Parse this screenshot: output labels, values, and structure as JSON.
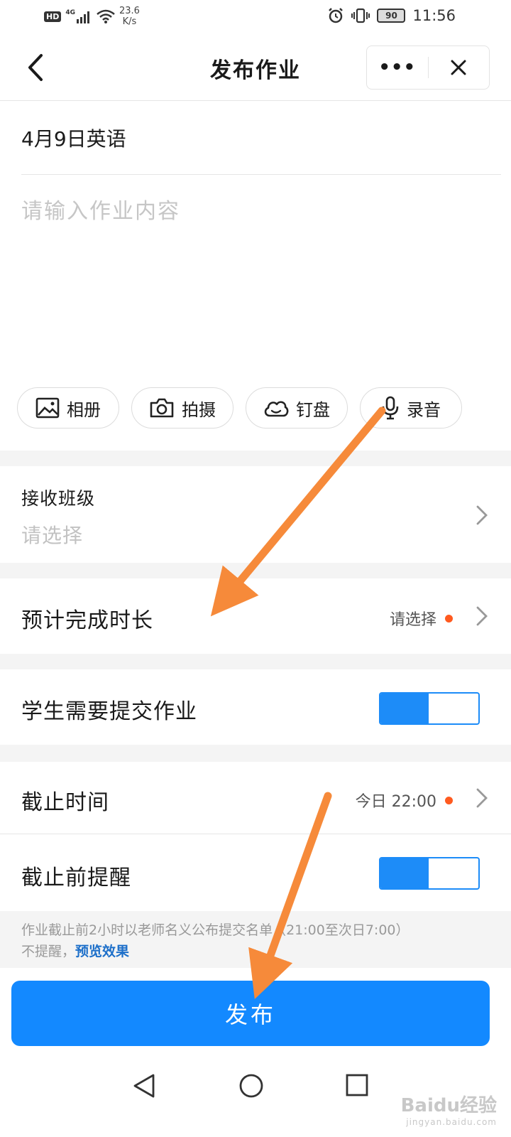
{
  "status_bar": {
    "hd": "HD",
    "network": "4G",
    "speed_value": "23.6",
    "speed_unit": "K/s",
    "battery": "90",
    "time": "11:56"
  },
  "nav": {
    "title": "发布作业",
    "more_label": "•••"
  },
  "form": {
    "title_value": "4月9日英语",
    "content_placeholder": "请输入作业内容"
  },
  "attachments": [
    {
      "label": "相册",
      "icon": "image-icon"
    },
    {
      "label": "拍摄",
      "icon": "camera-icon"
    },
    {
      "label": "钉盘",
      "icon": "cloud-icon"
    },
    {
      "label": "录音",
      "icon": "mic-icon"
    }
  ],
  "receive_class": {
    "label": "接收班级",
    "placeholder": "请选择"
  },
  "duration": {
    "label": "预计完成时长",
    "value": "请选择"
  },
  "submit_required": {
    "label": "学生需要提交作业",
    "on": true
  },
  "deadline": {
    "label": "截止时间",
    "value": "今日 22:00"
  },
  "reminder": {
    "label": "截止前提醒",
    "on": true
  },
  "hint": {
    "line1": "作业截止前2小时以老师名义公布提交名单（21:00至次日7:00）",
    "line2_prefix": "不提醒，",
    "link": "预览效果"
  },
  "publish_label": "发布",
  "watermark": {
    "brand": "Baidu经验",
    "url": "jingyan.baidu.com"
  },
  "colors": {
    "accent": "#1389ff",
    "toggle": "#1d8cf8",
    "dot": "#ff5a1f",
    "annotation_arrow": "#f68a3a"
  }
}
